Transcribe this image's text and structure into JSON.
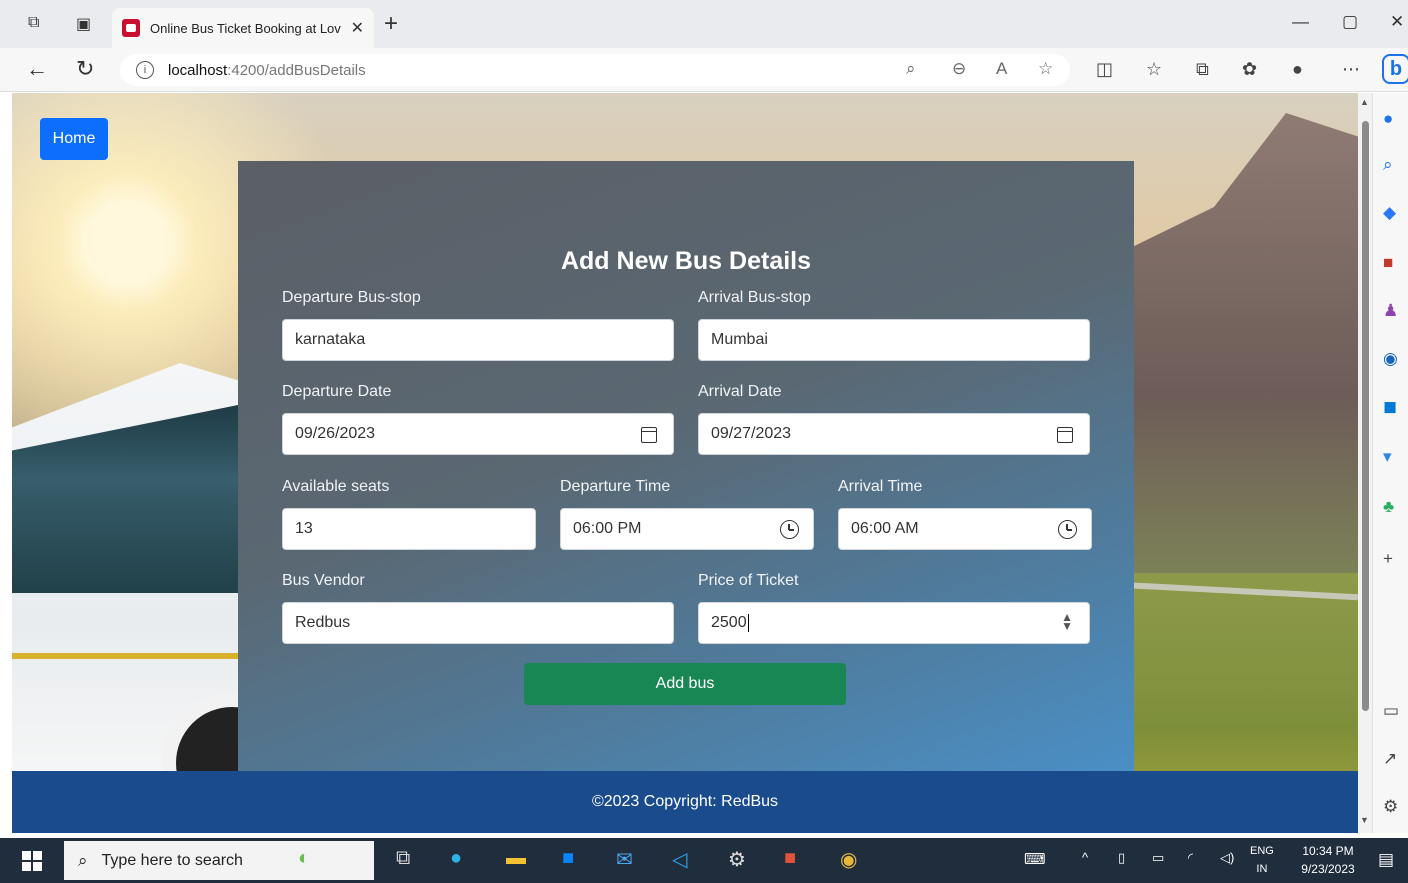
{
  "browser": {
    "tab_title": "Online Bus Ticket Booking at Lov",
    "url_host": "localhost",
    "url_path": ":4200/addBusDetails"
  },
  "page": {
    "home_label": "Home",
    "form_title": "Add New Bus Details",
    "labels": {
      "departure_stop": "Departure Bus-stop",
      "arrival_stop": "Arrival Bus-stop",
      "departure_date": "Departure Date",
      "arrival_date": "Arrival Date",
      "available_seats": "Available seats",
      "departure_time": "Departure Time",
      "arrival_time": "Arrival Time",
      "bus_vendor": "Bus Vendor",
      "price": "Price of Ticket"
    },
    "values": {
      "departure_stop": "karnataka",
      "arrival_stop": "Mumbai",
      "departure_date": "09/26/2023",
      "arrival_date": "09/27/2023",
      "available_seats": "13",
      "departure_time": "06:00 PM",
      "arrival_time": "06:00 AM",
      "bus_vendor": "Redbus",
      "price": "2500"
    },
    "submit_label": "Add bus",
    "footer": "©2023 Copyright: RedBus"
  },
  "taskbar": {
    "search_placeholder": "Type here to search",
    "lang_top": "ENG",
    "lang_bottom": "IN",
    "time": "10:34 PM",
    "date": "9/23/2023"
  },
  "colors": {
    "home_button": "#0d6efd",
    "submit_button": "#198754",
    "footer": "#1a4b8c"
  }
}
